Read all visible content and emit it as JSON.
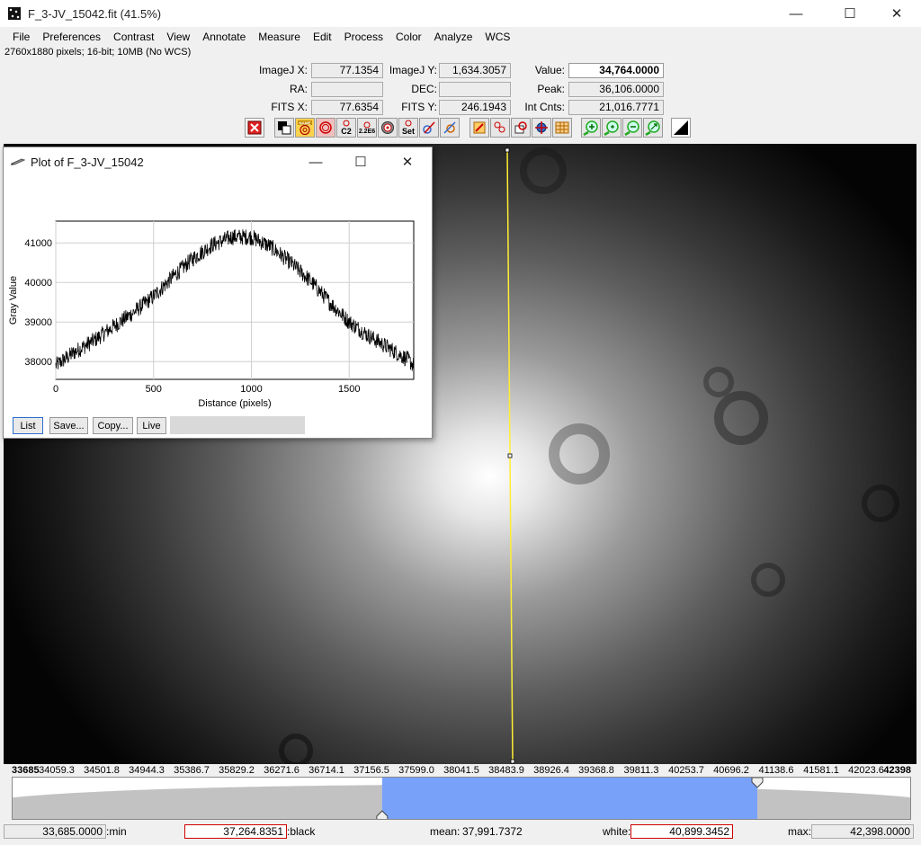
{
  "window": {
    "title": "F_3-JV_15042.fit (41.5%)",
    "minimize": "—",
    "maximize": "☐",
    "close": "✕"
  },
  "menu": [
    "File",
    "Preferences",
    "Contrast",
    "View",
    "Annotate",
    "Measure",
    "Edit",
    "Process",
    "Color",
    "Analyze",
    "WCS"
  ],
  "info_line": "2760x1880 pixels; 16-bit; 10MB (No WCS)",
  "readout": {
    "imagej_x_label": "ImageJ X:",
    "imagej_x": "77.1354",
    "imagej_y_label": "ImageJ Y:",
    "imagej_y": "1,634.3057",
    "value_label": "Value:",
    "value": "34,764.0000",
    "ra_label": "RA:",
    "ra": "",
    "dec_label": "DEC:",
    "dec": "",
    "peak_label": "Peak:",
    "peak": "36,106.0000",
    "fits_x_label": "FITS X:",
    "fits_x": "77.6354",
    "fits_y_label": "FITS Y:",
    "fits_y": "246.1943",
    "int_cnts_label": "Int Cnts:",
    "int_cnts": "21,016.7771"
  },
  "toolbar": {
    "c2": "C2",
    "c2e6": "2.2E6",
    "set": "Set",
    "name": "NAME"
  },
  "plot": {
    "title": "Plot of F_3-JV_15042",
    "buttons": {
      "list": "List",
      "save": "Save...",
      "copy": "Copy...",
      "live": "Live"
    },
    "chart_data": {
      "type": "line",
      "xlabel": "Distance (pixels)",
      "ylabel": "Gray Value",
      "xlim": [
        0,
        1830
      ],
      "ylim": [
        37550,
        41550
      ],
      "x_ticks": [
        "0",
        "500",
        "1000",
        "1500"
      ],
      "y_ticks": [
        "38000",
        "39000",
        "40000",
        "41000"
      ],
      "grid": true,
      "series": [
        {
          "x": [
            0,
            100,
            200,
            300,
            400,
            500,
            600,
            700,
            800,
            900,
            1000,
            1100,
            1200,
            1300,
            1400,
            1500,
            1600,
            1700,
            1800,
            1830
          ],
          "values": [
            37900,
            38250,
            38550,
            38900,
            39250,
            39650,
            40150,
            40600,
            40950,
            41150,
            41150,
            40900,
            40500,
            40050,
            39500,
            39000,
            38650,
            38350,
            38050,
            37900
          ]
        }
      ]
    }
  },
  "histogram": {
    "labels": [
      "33685",
      "34059.3",
      "34501.8",
      "34944.3",
      "35386.7",
      "35829.2",
      "36271.6",
      "36714.1",
      "37156.5",
      "37599.0",
      "38041.5",
      "38483.9",
      "38926.4",
      "39368.8",
      "39811.3",
      "40253.7",
      "40696.2",
      "41138.6",
      "41581.1",
      "42023.6",
      "42398"
    ],
    "range": [
      33685,
      42398
    ],
    "black_value": 37264.8351,
    "white_value": 40899.3452,
    "highlight_color": "#78a2fa"
  },
  "status": {
    "min": "33,685.0000",
    "min_label": ":min",
    "black": "37,264.8351",
    "black_label": ":black",
    "mean_label": "mean:",
    "mean": "37,991.7372",
    "white_label": "white:",
    "white": "40,899.3452",
    "max_label": "max:",
    "max": "42,398.0000"
  }
}
